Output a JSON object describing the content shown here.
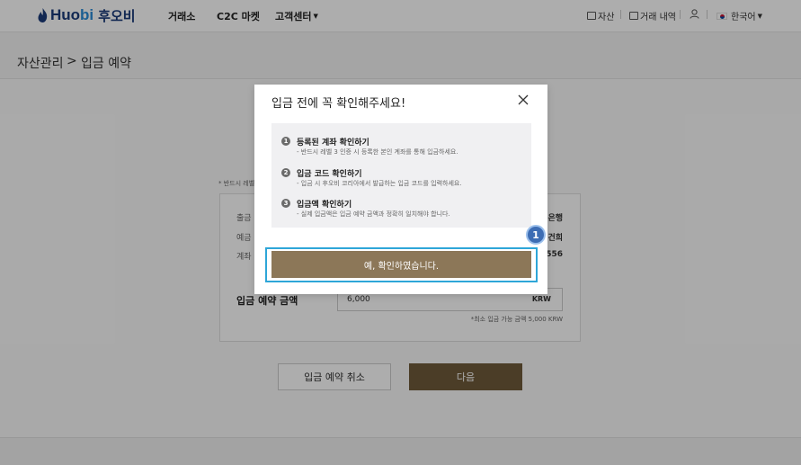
{
  "header": {
    "logo_en_a": "Huo",
    "logo_en_b": "bi",
    "logo_kr": "후오비",
    "nav": [
      "거래소",
      "C2C 마켓",
      "고객센터"
    ],
    "assets_label": "자산",
    "history_label": "거래 내역",
    "language_label": "한국어"
  },
  "breadcrumb": {
    "parent": "자산관리",
    "separator": ">",
    "current": "입금 예약"
  },
  "page": {
    "notice": "* 반드시 레벨",
    "info_rows": [
      {
        "label": "출금",
        "value": "은행"
      },
      {
        "label": "예금",
        "value": "건희"
      },
      {
        "label": "계좌",
        "value": "556"
      }
    ],
    "amount_label": "입금 예약 금액",
    "amount_value": "6,000",
    "amount_unit": "KRW",
    "min_note": "*최소 입금 가능 금액 5,000 KRW",
    "cancel_button": "입금 예약 취소",
    "next_button": "다음"
  },
  "modal": {
    "title": "입금 전에 꼭 확인해주세요!",
    "steps": [
      {
        "num": "1",
        "title": "등록된 계좌 확인하기",
        "desc": "- 반드시 레벨 3 인증 시 등록한 본인 계좌를 통해 입금하세요."
      },
      {
        "num": "2",
        "title": "입금 코드 확인하기",
        "desc": "- 입금 시 후오비 코리아에서 발급하는 입금 코드를 입력하세요."
      },
      {
        "num": "3",
        "title": "입금액 확인하기",
        "desc": "- 실제 입금액은 입금 예약 금액과 정확히 일치해야 합니다."
      }
    ],
    "confirm_button": "예, 확인하였습니다.",
    "callout_number": "1"
  },
  "colors": {
    "brand_navy": "#1a3a7a",
    "brand_blue": "#2a8bd8",
    "button_brown": "#6f5a3a",
    "confirm_brown": "#8c7758",
    "highlight_blue": "#2ea6d8",
    "callout_blue": "#3d6db4"
  }
}
